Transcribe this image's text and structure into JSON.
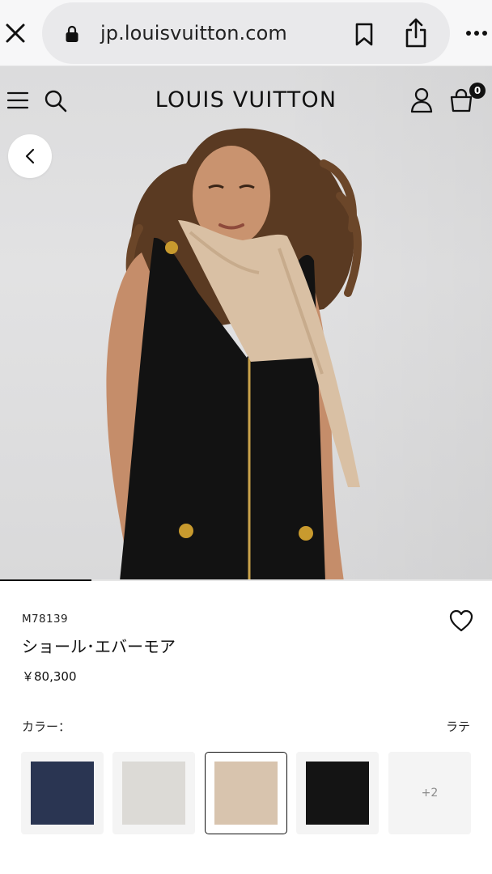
{
  "browser": {
    "url": "jp.louisvuitton.com"
  },
  "header": {
    "brand": "LOUIS VUITTON",
    "bag_count": "0"
  },
  "gallery": {
    "progress": 0.186
  },
  "product": {
    "sku": "M78139",
    "name": "ショール･エバーモア",
    "price": "￥80,300",
    "color_label": "カラー：",
    "selected_color": "ラテ"
  },
  "swatches": [
    {
      "color": "#2a3552"
    },
    {
      "color": "#dcdad6"
    },
    {
      "color": "#d8c4ae"
    },
    {
      "color": "#141414"
    }
  ],
  "swatch_more": "+2",
  "selected_swatch_index": 2,
  "icons": {
    "close": "close-icon",
    "lock": "lock-icon",
    "bookmark": "bookmark-icon",
    "share": "share-icon",
    "more": "more-icon",
    "menu": "menu-icon",
    "search": "search-icon",
    "account": "account-icon",
    "bag": "shopping-bag-icon",
    "back": "chevron-left-icon",
    "wishlist": "heart-icon"
  }
}
